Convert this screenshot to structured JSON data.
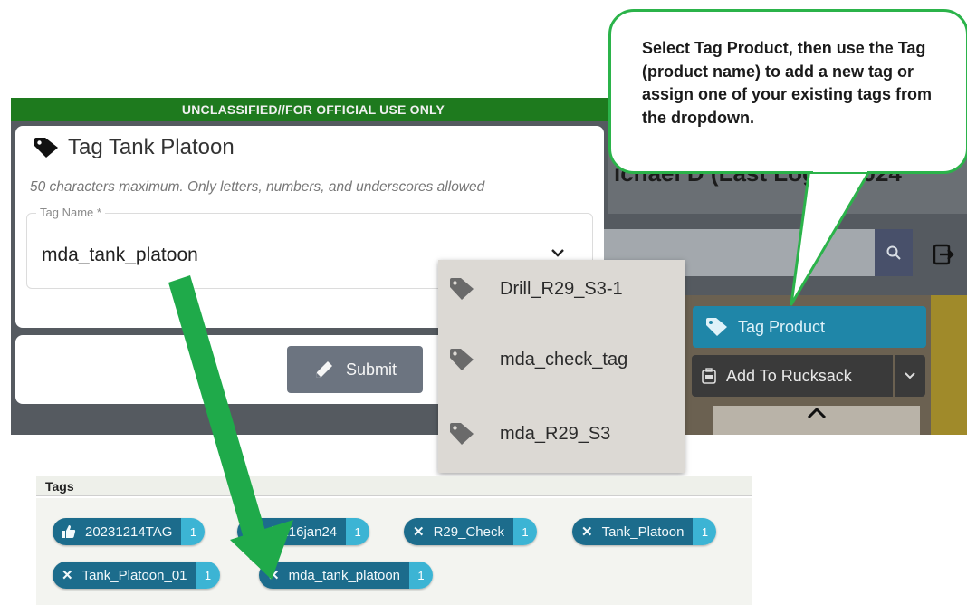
{
  "banner": {
    "text": "UNCLASSIFIED//FOR OFFICIAL USE ONLY"
  },
  "dialog": {
    "title": "Tag Tank Platoon",
    "hint": "50 characters maximum. Only letters, numbers, and underscores allowed",
    "field_label": "Tag Name *",
    "field_value": "mda_tank_platoon",
    "submit_label": "Submit"
  },
  "dropdown": {
    "options": [
      "Drill_R29_S3-1",
      "mda_check_tag",
      "mda_R29_S3"
    ]
  },
  "background": {
    "header_text": "ichael D (Last Logi... 2024",
    "tag_product_label": "Tag Product",
    "rucksack_label": "Add To Rucksack"
  },
  "callout": {
    "text": "Select Tag Product, then use the Tag (product name) to add a new tag or assign one of your existing tags from the dropdown."
  },
  "tags": {
    "header": "Tags",
    "chips": [
      {
        "label": "20231214TAG",
        "count": "1",
        "icon": "thumbs-up-icon"
      },
      {
        "label": "dex16jan24",
        "count": "1",
        "icon": "close-icon"
      },
      {
        "label": "R29_Check",
        "count": "1",
        "icon": "close-icon"
      },
      {
        "label": "Tank_Platoon",
        "count": "1",
        "icon": "close-icon"
      },
      {
        "label": "Tank_Platoon_01",
        "count": "1",
        "icon": "close-icon"
      },
      {
        "label": "mda_tank_platoon",
        "count": "1",
        "icon": "close-icon"
      }
    ]
  },
  "colors": {
    "banner_green": "#1e7a1e",
    "callout_border": "#2bb34a",
    "arrow_green": "#1faa4a",
    "tag_product_blue": "#1f86a8",
    "chip_dark": "#1c6c8c",
    "chip_count": "#3cb4d4"
  }
}
